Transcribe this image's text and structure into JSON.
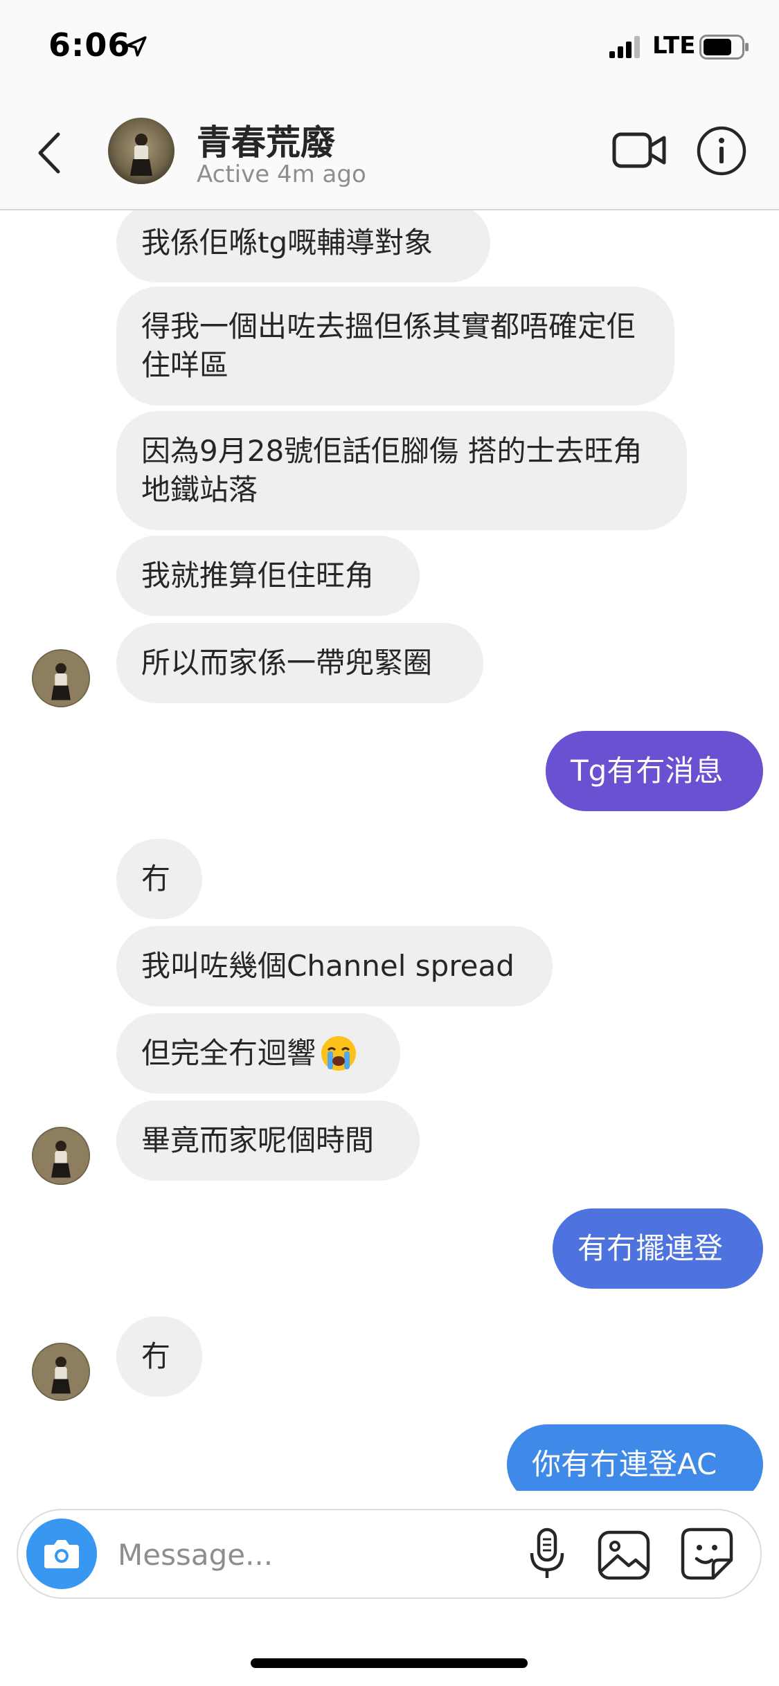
{
  "status_bar": {
    "time": "6:06",
    "network": "LTE",
    "location_icon": "location-arrow-icon",
    "signal_icon": "cellular-signal-icon",
    "battery_icon": "battery-icon"
  },
  "header": {
    "contact_name": "青春荒廢",
    "active_status": "Active 4m ago",
    "back_icon": "chevron-left-icon",
    "video_icon": "video-camera-icon",
    "info_icon": "info-icon"
  },
  "messages": [
    {
      "side": "in",
      "text": "我係佢喺tg嘅輔導對象"
    },
    {
      "side": "in",
      "text": "得我一個出咗去搵但係其實都唔確定佢住咩區"
    },
    {
      "side": "in",
      "text": "因為9月28號佢話佢腳傷 搭的士去旺角地鐵站落"
    },
    {
      "side": "in",
      "text": "我就推算佢住旺角"
    },
    {
      "side": "in",
      "text": "所以而家係一帶兜緊圈"
    },
    {
      "side": "out",
      "text": "Tg有冇消息"
    },
    {
      "side": "in",
      "text": "冇"
    },
    {
      "side": "in",
      "text": "我叫咗幾個Channel spread"
    },
    {
      "side": "in",
      "text": "但完全冇迴響"
    },
    {
      "side": "in",
      "text": "畢竟而家呢個時間"
    },
    {
      "side": "out",
      "text": "有冇擺連登"
    },
    {
      "side": "in",
      "text": "冇"
    },
    {
      "side": "out",
      "text": "你有冇連登AC"
    }
  ],
  "composer": {
    "placeholder": "Message...",
    "camera_icon": "camera-icon",
    "mic_icon": "microphone-icon",
    "gallery_icon": "gallery-icon",
    "sticker_icon": "sticker-icon"
  },
  "colors": {
    "incoming_bubble": "#efefef",
    "outgoing_purple": "#6a51d2",
    "outgoing_blue": "#4e73df",
    "outgoing_light_blue": "#3f8ae8",
    "camera_button": "#3897f0"
  }
}
